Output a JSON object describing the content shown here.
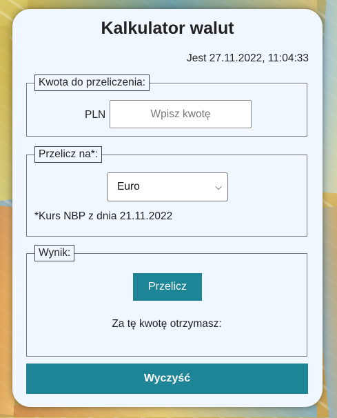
{
  "app": {
    "title": "Kalkulator walut",
    "datetime": "Jest 27.11.2022, 11:04:33"
  },
  "amount_section": {
    "legend": "Kwota do przeliczenia:",
    "currency_code": "PLN",
    "input_placeholder": "Wpisz kwotę",
    "input_value": ""
  },
  "convert_section": {
    "legend": "Przelicz na*:",
    "selected_currency": "Euro",
    "rate_note": "*Kurs NBP z dnia 21.11.2022"
  },
  "result_section": {
    "legend": "Wynik:",
    "calculate_label": "Przelicz",
    "result_text": "Za tę kwotę otrzymasz:"
  },
  "clear_label": "Wyczyść",
  "colors": {
    "accent": "#1e8597",
    "card_bg": "#f0f7ff"
  }
}
